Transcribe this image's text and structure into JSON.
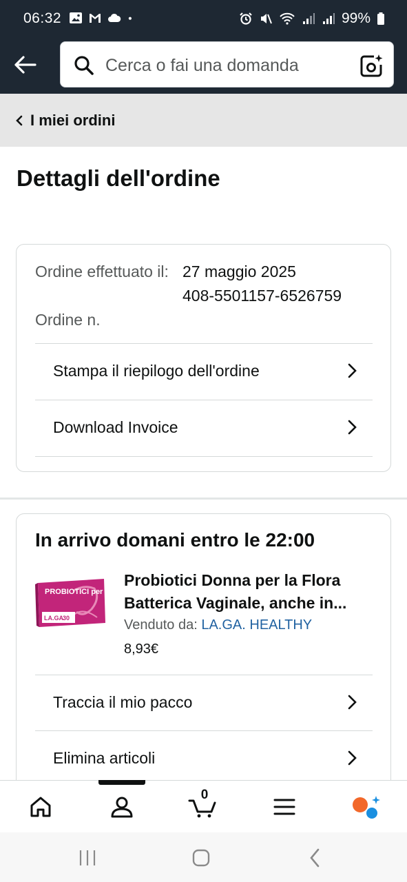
{
  "status_bar": {
    "time": "06:32",
    "battery": "99%",
    "icons": [
      "image-icon",
      "gmail-icon",
      "cloud-icon",
      "dot-icon",
      "alarm-icon",
      "mute-icon",
      "wifi-icon",
      "signal-icon",
      "signal-icon",
      "battery-icon"
    ]
  },
  "header": {
    "search_placeholder": "Cerca o fai una domanda"
  },
  "breadcrumb": {
    "label": "I miei ordini"
  },
  "page": {
    "title": "Dettagli dell'ordine"
  },
  "order_summary": {
    "date_label": "Ordine effettuato il:",
    "date_value": "27 maggio 2025",
    "number_label": "Ordine n.",
    "number_value": "408-5501157-6526759",
    "actions": [
      {
        "label": "Stampa il riepilogo dell'ordine"
      },
      {
        "label": "Download Invoice"
      }
    ]
  },
  "shipment": {
    "arrival": "In arrivo domani entro le 22:00",
    "product": {
      "title": "Probiotici Donna per la Flora Batterica Vaginale, anche in...",
      "seller_label": "Venduto da:",
      "seller_name": "LA.GA. HEALTHY",
      "price": "8,93€",
      "image_text": "PROBIOTICI per DONNA",
      "image_brand": "LA.GA",
      "image_count": "30"
    },
    "actions": [
      {
        "label": "Traccia il mio pacco"
      },
      {
        "label": "Elimina articoli"
      }
    ]
  },
  "bottom_nav": {
    "items": [
      "home-icon",
      "account-icon",
      "cart-icon",
      "menu-icon",
      "rufus-icon"
    ],
    "cart_count": "0",
    "active": "account-icon"
  },
  "colors": {
    "header_bg": "#1e2833",
    "link": "#2162a1",
    "breadcrumb_bg": "#e6e6e6",
    "product_pink": "#c2257a"
  }
}
